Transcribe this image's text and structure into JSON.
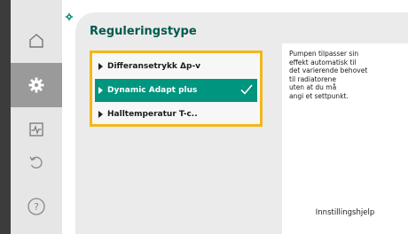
{
  "header": {
    "title": "Reguleringstype"
  },
  "sidebar": {
    "items": [
      {
        "icon": "home-icon"
      },
      {
        "icon": "settings-icon",
        "active": true
      },
      {
        "icon": "diagnostics-icon"
      },
      {
        "icon": "undo-icon"
      },
      {
        "icon": "help-icon"
      }
    ]
  },
  "breadcrumb": {
    "icon": "settings-icon"
  },
  "options": [
    {
      "label": "Differansetrykk Δp-v",
      "selected": false
    },
    {
      "label": "Dynamic Adapt plus",
      "selected": true
    },
    {
      "label": "Halltemperatur T-c..",
      "selected": false
    }
  ],
  "help": {
    "text": "Pumpen tilpasser sin\neffekt automatisk til\ndet varierende behovet\ntil radiatorene\nuten at du må\nangi et settpunkt.",
    "button_label": "Innstillingshjelp"
  },
  "colors": {
    "accent": "#00957f",
    "title": "#005a4b",
    "focus": "#f3b71a"
  }
}
